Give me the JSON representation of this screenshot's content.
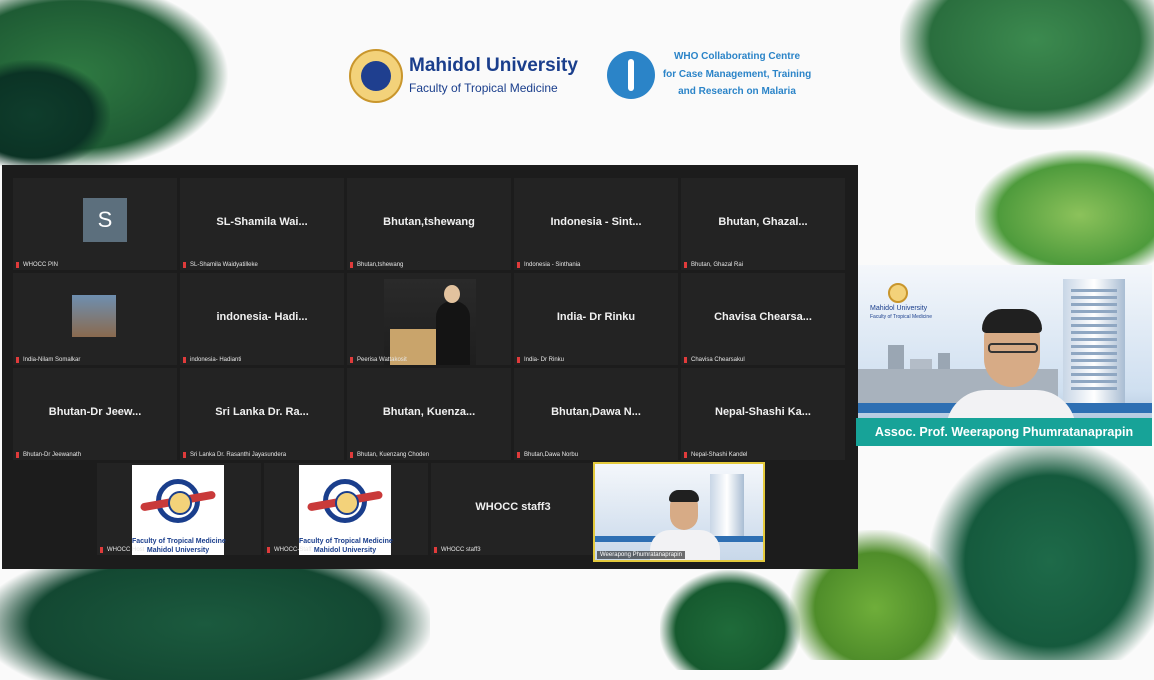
{
  "header": {
    "university_name": "Mahidol University",
    "faculty": "Faculty of Tropical Medicine",
    "who_line1": "WHO Collaborating Centre",
    "who_line2": "for Case Management, Training",
    "who_line3": "and Research on Malaria"
  },
  "gallery": {
    "rows": [
      [
        {
          "display": "",
          "label": "WHOCC PIN",
          "avatar_letter": "S"
        },
        {
          "display": "SL-Shamila Wai...",
          "label": "SL-Shamila Waidyatilleke"
        },
        {
          "display": "Bhutan,tshewang",
          "label": "Bhutan,tshewang"
        },
        {
          "display": "Indonesia - Sint...",
          "label": "Indonesia - Sinthania"
        },
        {
          "display": "Bhutan, Ghazal...",
          "label": "Bhutan, Ghazal Rai"
        }
      ],
      [
        {
          "display": "",
          "label": "India-Nilam Somalkar"
        },
        {
          "display": "indonesia- Hadi...",
          "label": "indonesia- Hadianti"
        },
        {
          "display": "",
          "label": "Peerisa Wattakosit"
        },
        {
          "display": "India- Dr Rinku",
          "label": "India- Dr Rinku"
        },
        {
          "display": "Chavisa Chearsa...",
          "label": "Chavisa Chearsakul"
        }
      ],
      [
        {
          "display": "Bhutan-Dr Jeew...",
          "label": "Bhutan-Dr Jeewanath"
        },
        {
          "display": "Sri Lanka Dr. Ra...",
          "label": "Sri Lanka Dr. Rasanthi Jayasundera"
        },
        {
          "display": "Bhutan, Kuenza...",
          "label": "Bhutan, Kuenzang Choden"
        },
        {
          "display": "Bhutan,Dawa N...",
          "label": "Bhutan,Dawa Norbu"
        },
        {
          "display": "Nepal-Shashi Ka...",
          "label": "Nepal-Shashi Kandel"
        }
      ]
    ],
    "bottom": [
      {
        "display": "",
        "label": "WHOCC Host"
      },
      {
        "display": "",
        "label": "WHOCC-Staff"
      },
      {
        "display": "WHOCC staff3",
        "label": "WHOCC staff3"
      },
      {
        "display": "",
        "label": "Weerapong Phumratanaprapin"
      }
    ],
    "logo_caption_1": "Faculty of Tropical Medicine",
    "logo_caption_2": "Mahidol University"
  },
  "speaker": {
    "slide_university": "Mahidol University",
    "slide_faculty": "Faculty of Tropical Medicine",
    "caption": "Assoc. Prof. Weerapong Phumratanaprapin"
  }
}
